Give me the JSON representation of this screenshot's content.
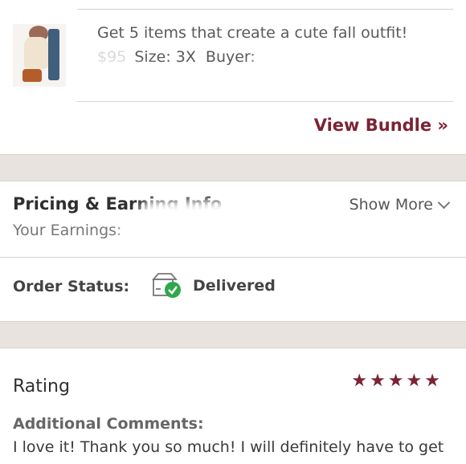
{
  "item": {
    "title": "Get 5 items that create a cute fall outfit!",
    "price_partial": "$95",
    "size": "Size: 3X",
    "buyer": "Buyer:",
    "image_icon": "outfit-thumbnail"
  },
  "bundle": {
    "link_label": "View Bundle »"
  },
  "pricing": {
    "title": "Pricing & Earning Info",
    "show_more_label": "Show More",
    "chevron_icon": "chevron-down-icon",
    "earnings_label": "Your Earnings:"
  },
  "order": {
    "status_label": "Order Status:",
    "status_value": "Delivered",
    "status_icon": "delivered-box-icon",
    "check_color": "#2ea84a"
  },
  "rating": {
    "label": "Rating",
    "stars": 5,
    "star_glyph": "★",
    "star_color": "#7b2334",
    "comments_label": "Additional Comments:",
    "comment_text": "I love it! Thank you so much! I will definitely have to get"
  },
  "colors": {
    "accent": "#7b2334",
    "band": "#e8e3df",
    "divider": "#d7d4d2"
  }
}
